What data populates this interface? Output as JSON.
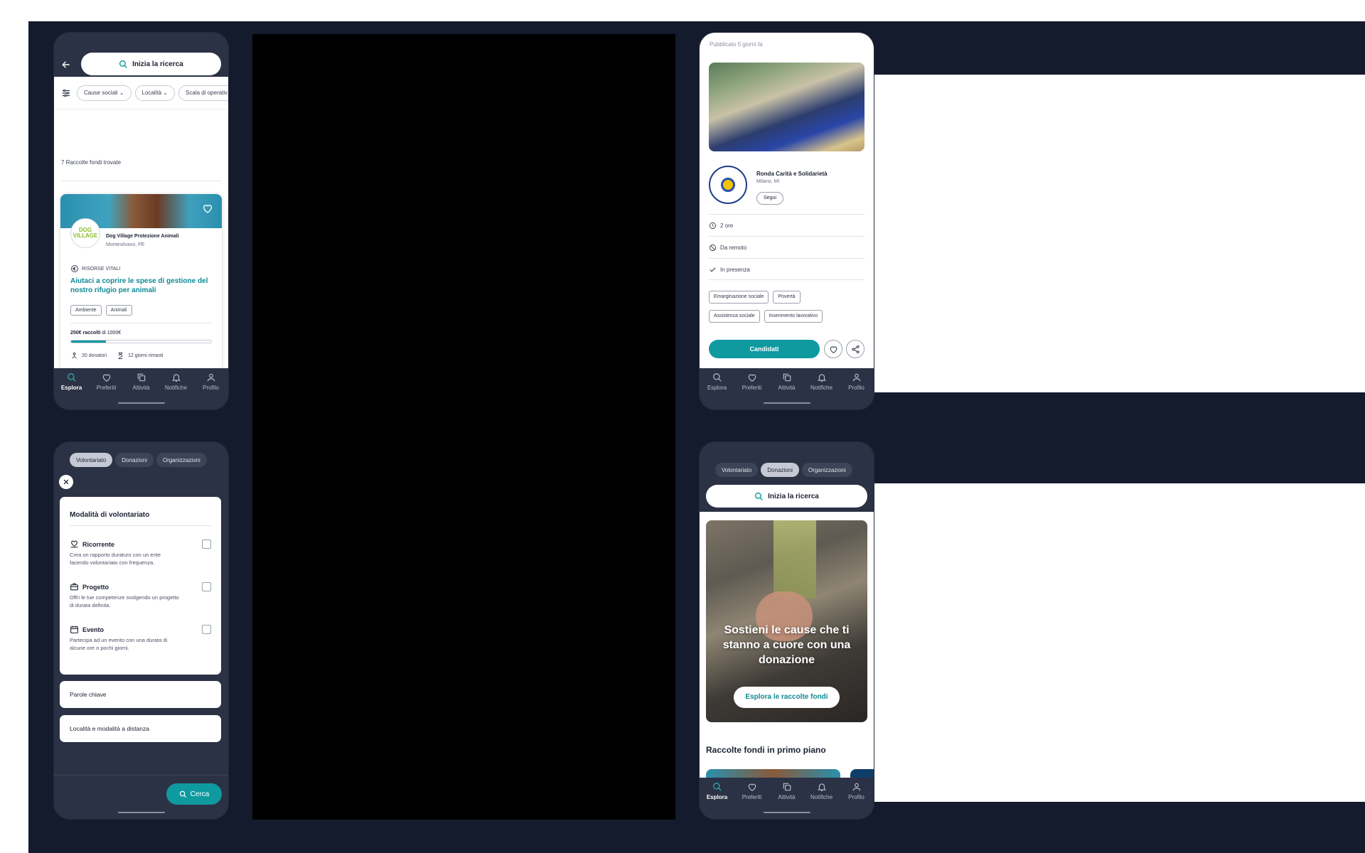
{
  "colors": {
    "accent": "#0f9aa0",
    "navy": "#141b2d",
    "panel": "#2c3245",
    "card": "#ffffff"
  },
  "tabbar": {
    "items": [
      {
        "label": "Esplora",
        "icon": "search-icon"
      },
      {
        "label": "Preferiti",
        "icon": "heart-icon"
      },
      {
        "label": "Attività",
        "icon": "copy-icon"
      },
      {
        "label": "Notifiche",
        "icon": "bell-icon"
      },
      {
        "label": "Profilo",
        "icon": "user-icon"
      }
    ]
  },
  "screen1": {
    "search_label": "Inizia la ricerca",
    "filters": [
      "Cause sociali",
      "Località",
      "Scala di operativ"
    ],
    "results_count": "7 Raccolte fondi trovate",
    "card": {
      "org_logo_text": "DOG VILLAGE",
      "org_name": "Dog Village Protezione Animali",
      "org_location": "Montesilvano, PE",
      "category": "RISORSE VITALI",
      "title": "Aiutaci a coprire le spese di gestione del nostro rifugio per animali",
      "tags": [
        "Ambiente",
        "Animali"
      ],
      "raised_amount": "250€ raccolti",
      "raised_of": " di 1000€",
      "progress": 0.25,
      "donors": "20 donatori",
      "days_left": "12 giorni rimasti"
    }
  },
  "screen2": {
    "published": "Pubblicato 5 giorni fa",
    "org_name": "Ronda Carità e Solidarietà",
    "org_location": "Milano, MI",
    "follow_label": "Segui",
    "details": [
      {
        "icon": "clock-icon",
        "text": "2 ore"
      },
      {
        "icon": "no-icon",
        "text": "Da remoto"
      },
      {
        "icon": "check-icon",
        "text": "In presenza"
      }
    ],
    "tags_row1": [
      "Emarginazione sociale",
      "Povertà"
    ],
    "tags_row2": [
      "Assistenza sociale",
      "Inserimento lavorativo"
    ],
    "apply_label": "Candidati"
  },
  "screen3": {
    "segments": [
      "Volontariato",
      "Donazioni",
      "Organizzazioni"
    ],
    "panel_title": "Modalità di volontariato",
    "options": [
      {
        "title": "Ricorrente",
        "icon": "heart-hand-icon",
        "desc": "Crea un rapporto duraturo con un ente facendo volontariato con frequenza."
      },
      {
        "title": "Progetto",
        "icon": "briefcase-icon",
        "desc": "Offri le tue competenze svolgendo un progetto di durata definita."
      },
      {
        "title": "Evento",
        "icon": "calendar-icon",
        "desc": "Partecipa ad un evento con una durata di alcune ore o pochi giorni."
      }
    ],
    "section_keywords": "Parole chiave",
    "section_location": "Località e modalità a distanza",
    "search_button": "Cerca"
  },
  "screen4": {
    "segments": [
      "Volontariato",
      "Donazioni",
      "Organizzazioni"
    ],
    "search_label": "Inizia la ricerca",
    "hero_title": "Sostieni le cause che ti stanno a cuore con una donazione",
    "hero_button": "Esplora le raccolte fondi",
    "featured_title": "Raccolte fondi in primo piano"
  }
}
